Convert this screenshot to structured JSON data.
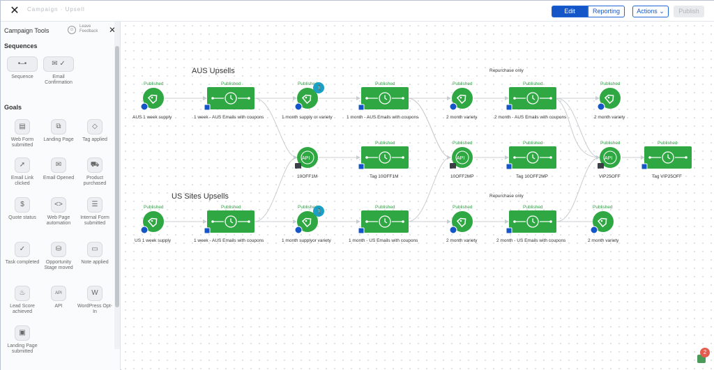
{
  "header": {
    "title_ghost": "Campaign · Upsell",
    "edit_label": "Edit",
    "reporting_label": "Reporting",
    "actions_label": "Actions ⌄",
    "publish_label": "Publish"
  },
  "sidebar": {
    "title": "Campaign Tools",
    "feedback_label": "Leave Feedback",
    "sequences_title": "Sequences",
    "goals_title": "Goals",
    "sequences": [
      {
        "label": "Sequence",
        "icon": "sequence-icon"
      },
      {
        "label": "Email Confirmation",
        "icon": "email-confirmation-icon"
      }
    ],
    "goals": [
      {
        "label": "Web Form submitted",
        "icon": "web-form-icon"
      },
      {
        "label": "Landing Page",
        "icon": "landing-page-icon"
      },
      {
        "label": "Tag applied",
        "icon": "tag-icon"
      },
      {
        "label": "Email Link clicked",
        "icon": "cursor-icon"
      },
      {
        "label": "Email Opened",
        "icon": "envelope-icon"
      },
      {
        "label": "Product purchased",
        "icon": "cart-icon"
      },
      {
        "label": "Quote status",
        "icon": "dollar-icon"
      },
      {
        "label": "Web Page automation",
        "icon": "code-icon"
      },
      {
        "label": "Internal Form submitted",
        "icon": "form-icon"
      },
      {
        "label": "Task completed",
        "icon": "check-icon"
      },
      {
        "label": "Opportunity Stage moved",
        "icon": "stage-icon"
      },
      {
        "label": "Note applied",
        "icon": "note-icon"
      },
      {
        "label": "Lead Score achieved",
        "icon": "flame-icon"
      },
      {
        "label": "API",
        "icon": "api-icon"
      },
      {
        "label": "WordPress Opt-In",
        "icon": "wordpress-icon"
      },
      {
        "label": "Landing Page submitted",
        "icon": "landing-submit-icon"
      }
    ]
  },
  "canvas": {
    "groups": [
      "AUS Upsells",
      "US Sites Upsells"
    ],
    "repurchase_label": "Repurchase only",
    "status_label": "Published",
    "nodes": {
      "aus_goal_1": "AUS 1 week supply",
      "aus_seq_1": "1 week - AUS Emails with coupons",
      "aus_goal_2": "1 month supply or variety",
      "aus_seq_2": "1 month - AUS Emails with coupons",
      "aus_goal_3": "2 month variety",
      "aus_seq_3": "2 month - AUS Emails with coupons",
      "aus_goal_4": "2 month variety",
      "api_1": "10OFF1M",
      "tag_seq_1": "Tag 10OFF1M",
      "api_2": "10OFF2MP",
      "tag_seq_2": "Tag 10OFF2MP",
      "api_3": "VIP25OFF",
      "tag_seq_3": "Tag VIP25OFF",
      "us_goal_1": "US 1 week supply",
      "us_seq_1": "1 week - AUS Emails with coupons",
      "us_goal_2": "1 month supplyor variety",
      "us_seq_2": "1 month - US Emails with coupons",
      "us_goal_3": "2 month variety",
      "us_seq_3": "2 month - US Emails with coupons",
      "us_goal_4": "2 month variety"
    },
    "api_text": "API",
    "notification_count": "2"
  },
  "colors": {
    "green": "#2fa843",
    "blue": "#1456c8",
    "teal": "#1b9fc6"
  }
}
